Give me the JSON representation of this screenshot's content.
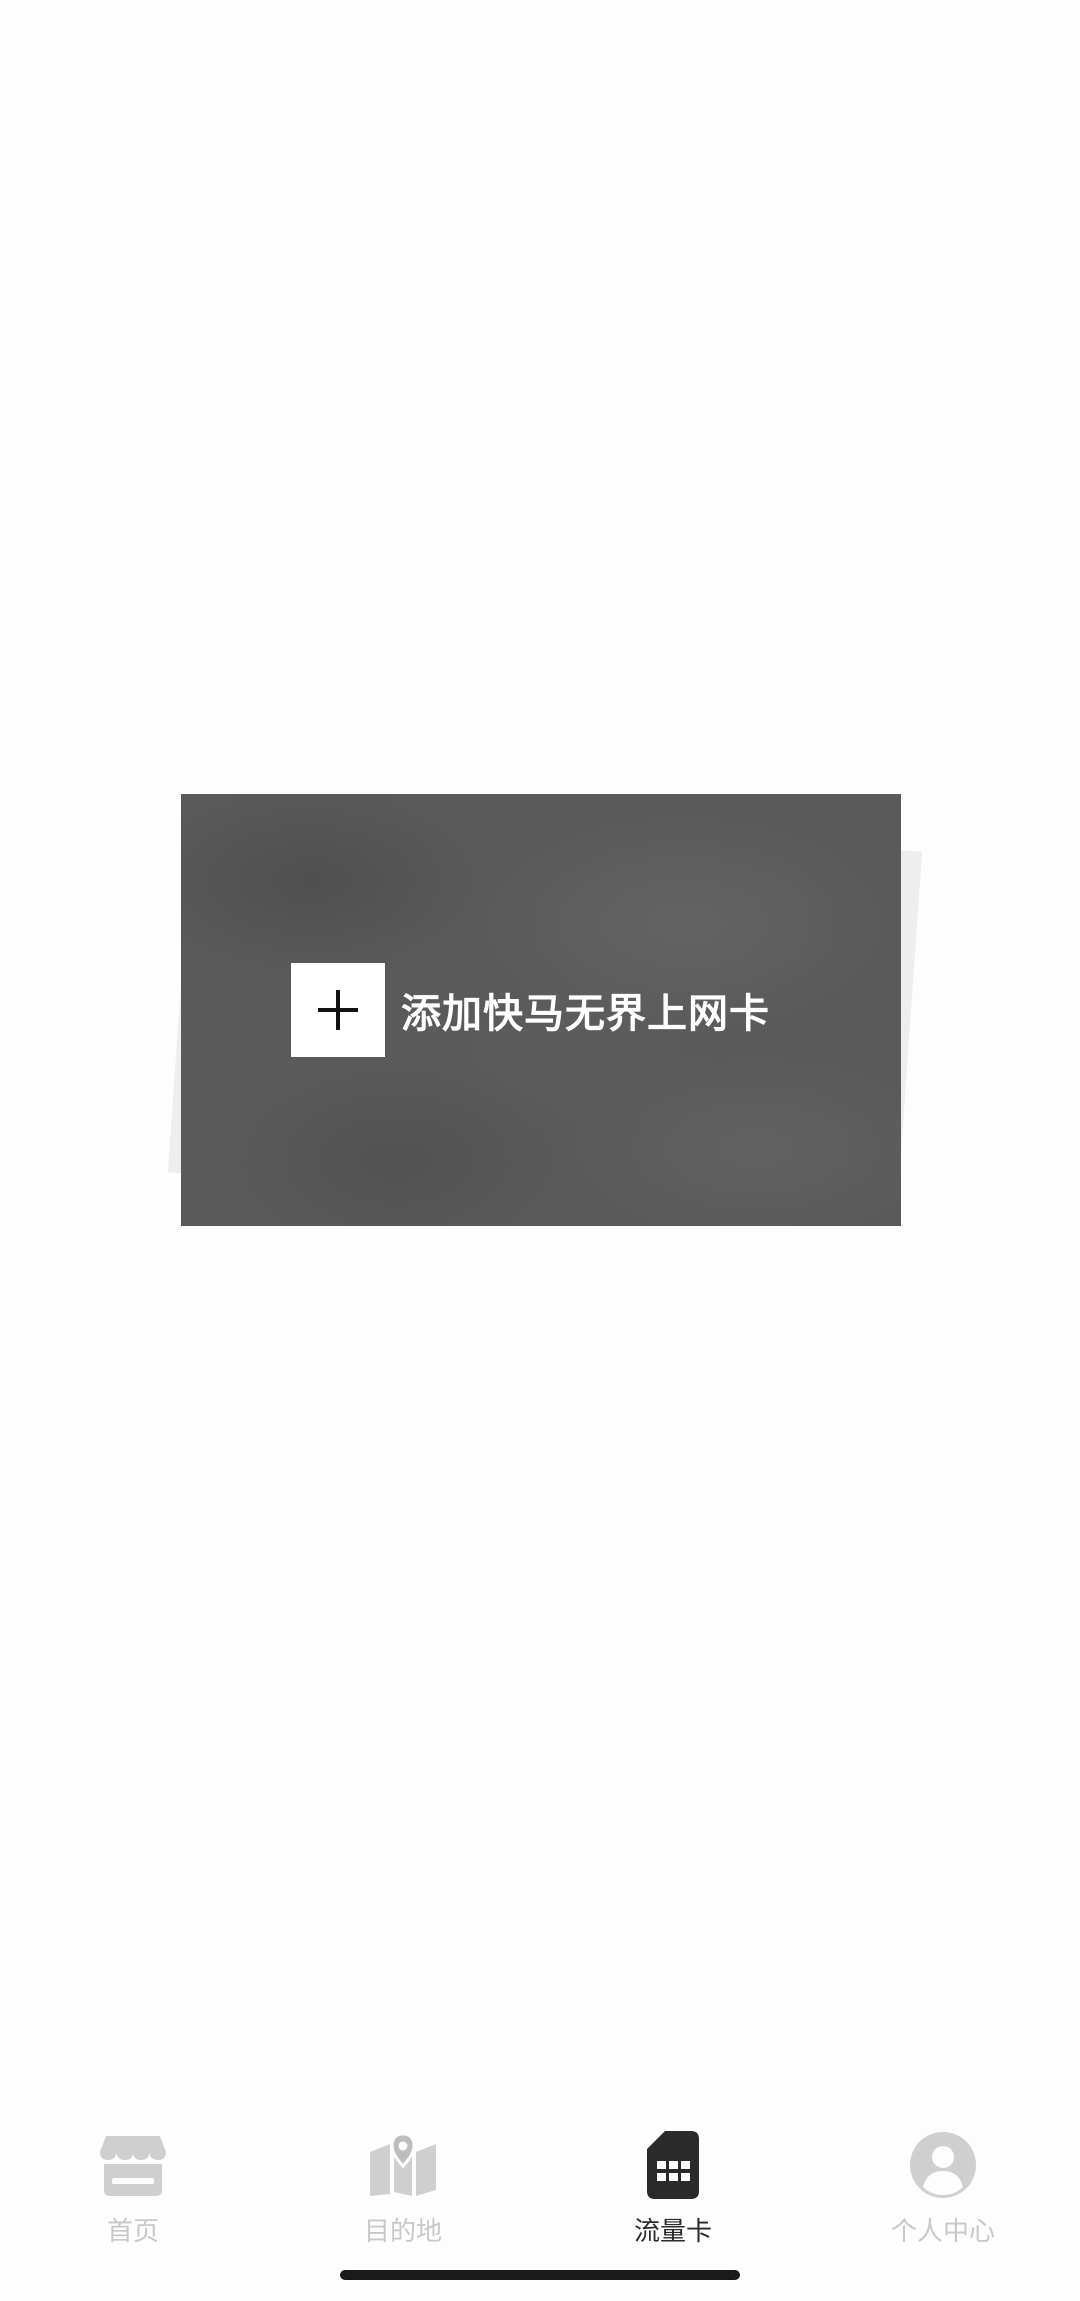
{
  "add_card": {
    "label": "添加快马无界上网卡",
    "plus_icon": "plus-icon"
  },
  "tabbar": {
    "active_index": 2,
    "colors": {
      "inactive": "#c8c8c8",
      "active": "#2a2a2a"
    },
    "tabs": [
      {
        "label": "首页",
        "icon": "store-icon"
      },
      {
        "label": "目的地",
        "icon": "map-pin-icon"
      },
      {
        "label": "流量卡",
        "icon": "sim-card-icon"
      },
      {
        "label": "个人中心",
        "icon": "user-circle-icon"
      }
    ]
  }
}
